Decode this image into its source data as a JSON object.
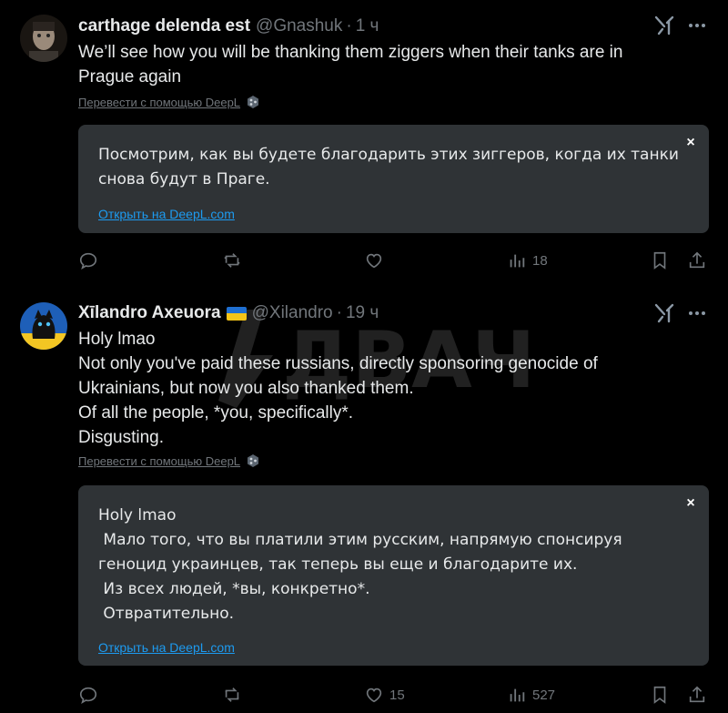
{
  "watermark": {
    "text": "ДВАЧ"
  },
  "tweets": [
    {
      "author_name": "carthage delenda est",
      "handle": "@Gnashuk",
      "separator": "·",
      "time": "1 ч",
      "has_flag": false,
      "lines": [
        "We’ll see how you will be thanking them ziggers when their tanks are in",
        "Prague again"
      ],
      "translate_label": "Перевести с помощью DeepL",
      "translation": {
        "close_label": "×",
        "lines": [
          "Посмотрим, как вы будете благодарить этих зиггеров, когда их танки",
          "снова будут в Праге."
        ],
        "link_label": "Открыть на DeepL.com"
      },
      "actions": {
        "reply": "",
        "retweet": "",
        "like": "",
        "views": "18"
      }
    },
    {
      "author_name": "Xīlandro Axeuora",
      "handle": "@Xilandro",
      "separator": "·",
      "time": "19 ч",
      "has_flag": true,
      "lines": [
        "Holy lmao",
        "Not only you've paid these russians, directly sponsoring genocide of",
        "Ukrainians, but now you also thanked them.",
        "Of all the people, *you, specifically*.",
        "Disgusting."
      ],
      "translate_label": "Перевести с помощью DeepL",
      "translation": {
        "close_label": "×",
        "lines": [
          "Holy lmao",
          " Мало того, что вы платили этим русским, напрямую спонсируя",
          "геноцид украинцев, так теперь вы еще и благодарите их.",
          " Из всех людей, *вы, конкретно*.",
          " Отвратительно."
        ],
        "link_label": "Открыть на DeepL.com"
      },
      "actions": {
        "reply": "",
        "retweet": "",
        "like": "15",
        "views": "527"
      }
    }
  ],
  "icons": {
    "more": "more-horizontal-icon",
    "grok": "grok-icon",
    "reply": "reply-icon",
    "retweet": "retweet-icon",
    "like": "heart-icon",
    "views": "views-icon",
    "bookmark": "bookmark-icon",
    "share": "share-icon",
    "deepl": "deepl-icon"
  },
  "colors": {
    "background": "#000000",
    "card": "#2f3336",
    "muted": "#71767b",
    "link": "#1d9bf0",
    "text": "#e7e9ea"
  }
}
